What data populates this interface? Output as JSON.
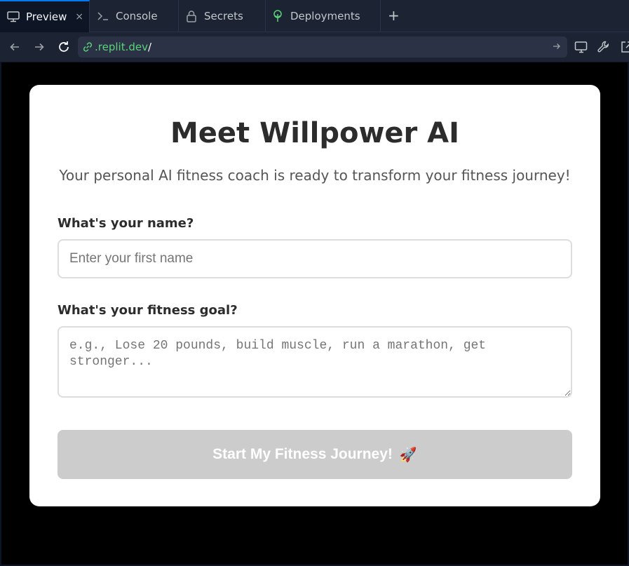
{
  "tabs": [
    {
      "label": "Preview",
      "icon": "monitor-icon",
      "active": true
    },
    {
      "label": "Console",
      "icon": "terminal-icon",
      "active": false
    },
    {
      "label": "Secrets",
      "icon": "lock-icon",
      "active": false
    },
    {
      "label": "Deployments",
      "icon": "deployments-icon",
      "active": false
    }
  ],
  "tab_close_glyph": "×",
  "new_tab_glyph": "+",
  "menu_glyph": "⋮",
  "url": {
    "domain": ".replit.dev",
    "path": "/"
  },
  "page": {
    "title": "Meet Willpower AI",
    "subtitle": "Your personal AI fitness coach is ready to transform your fitness journey!",
    "name_label": "What's your name?",
    "name_placeholder": "Enter your first name",
    "goal_label": "What's your fitness goal?",
    "goal_placeholder": "e.g., Lose 20 pounds, build muscle, run a marathon, get stronger...",
    "submit_label": "Start My Fitness Journey!",
    "submit_emoji": "🚀"
  },
  "colors": {
    "ide_bg": "#1c2333",
    "accent": "#0079f2",
    "url_domain": "#5bd37a",
    "button_disabled": "#cccccc"
  }
}
